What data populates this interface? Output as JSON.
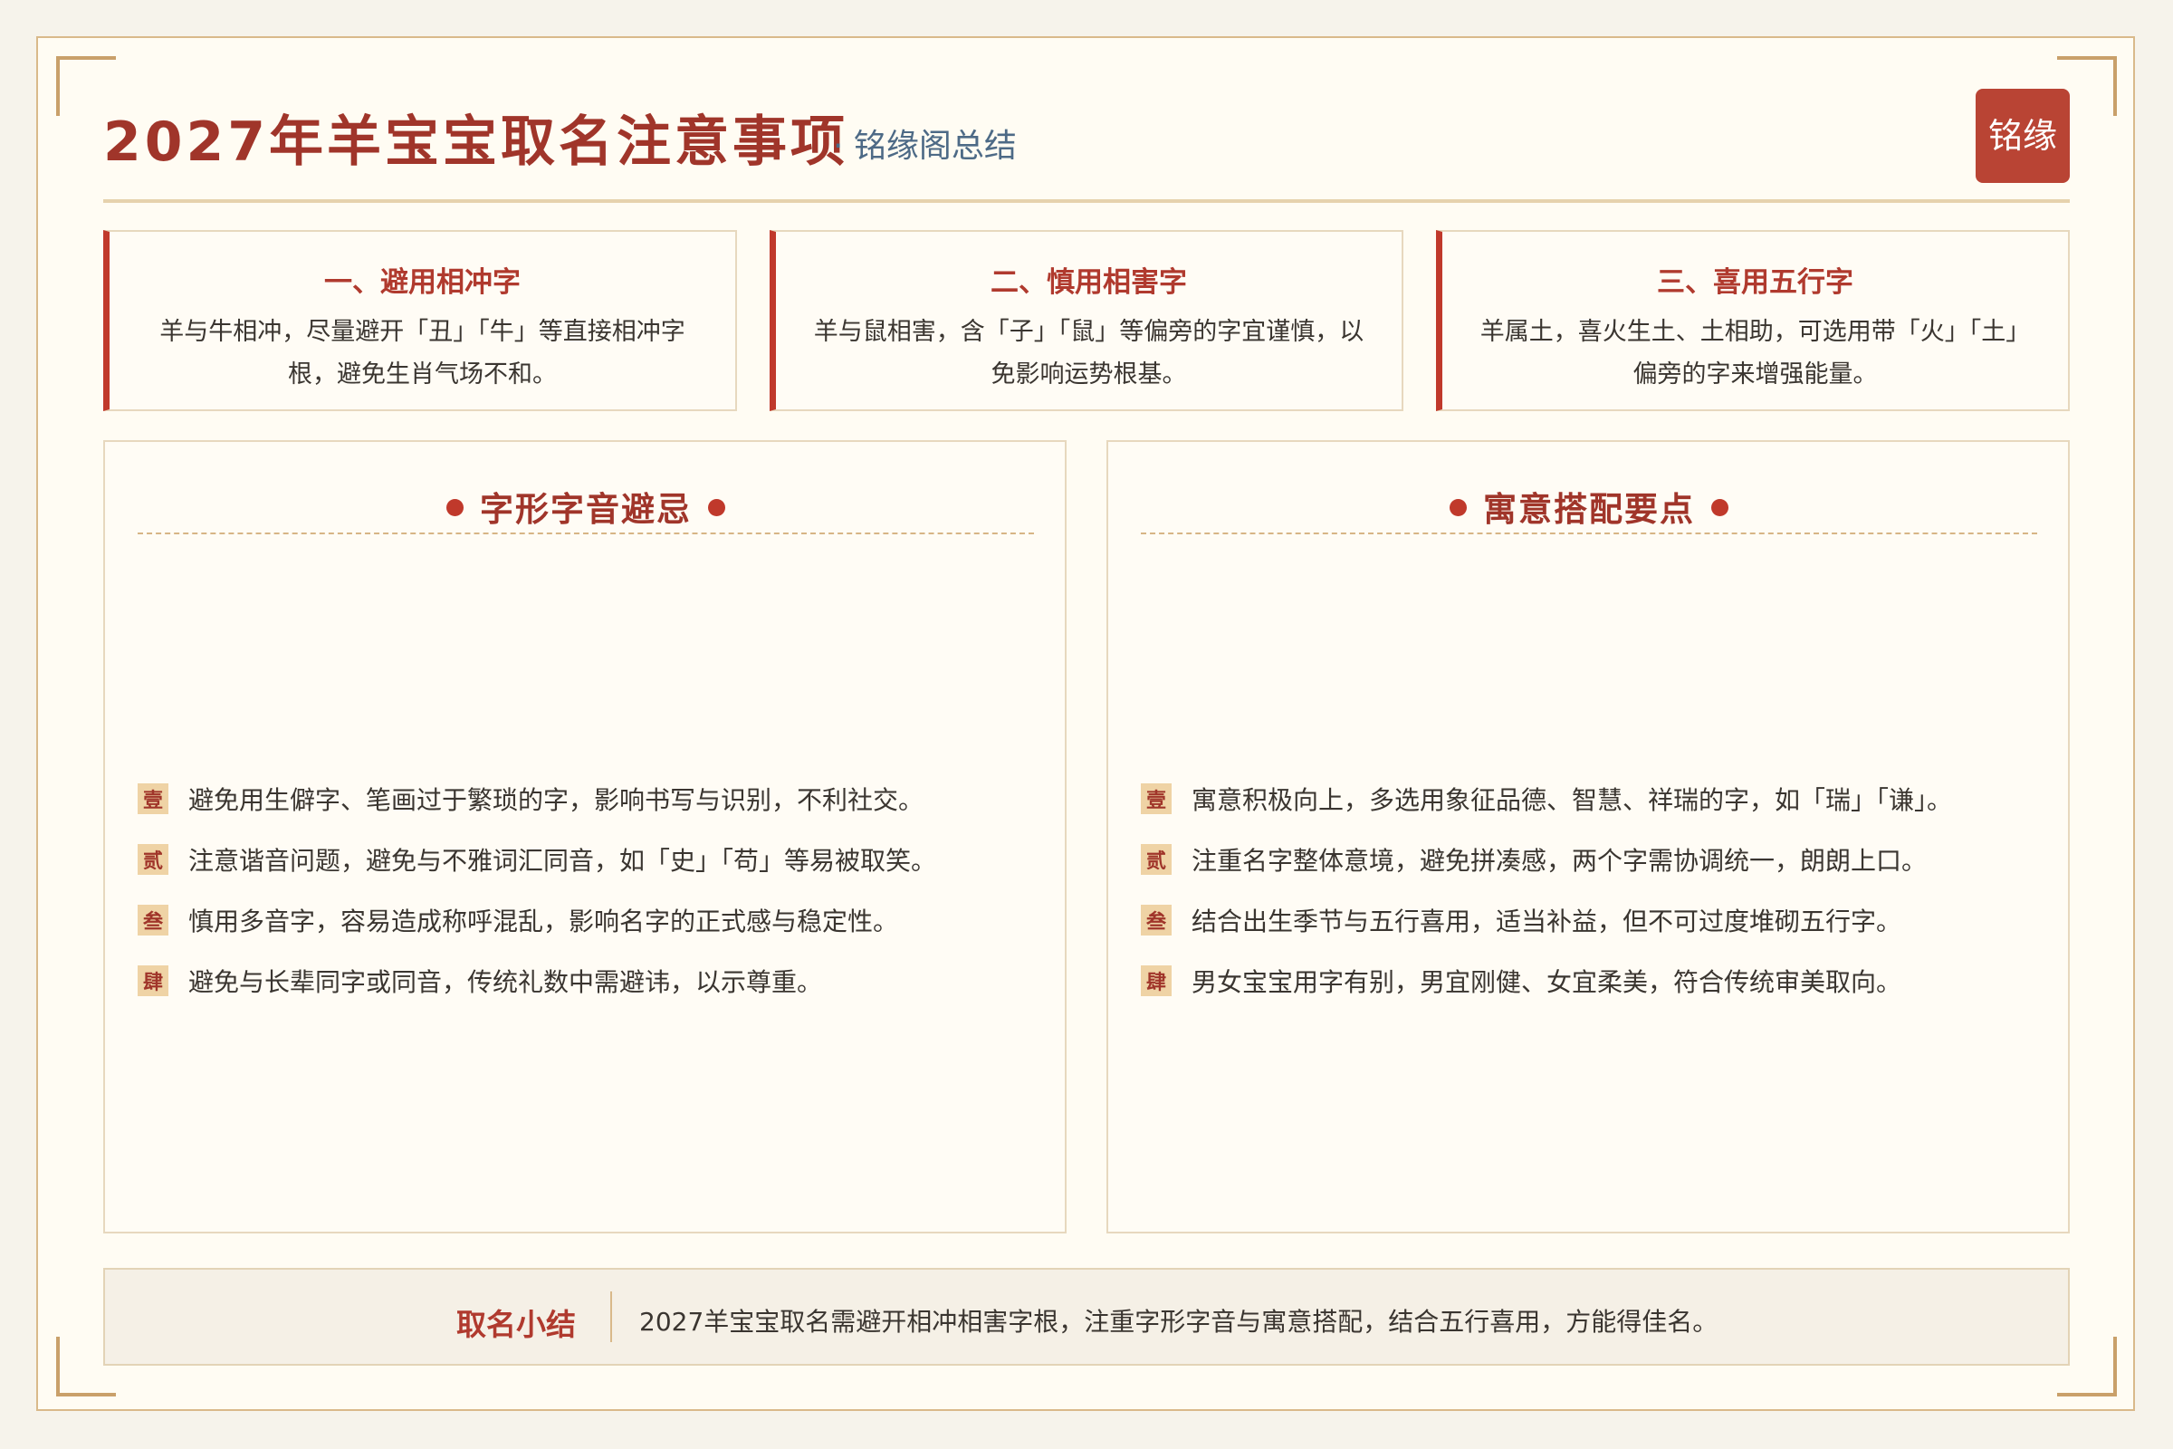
{
  "header": {
    "title": "2027年羊宝宝取名注意事项",
    "subtitle": "· 铭缘阁总结",
    "seal_text": "铭缘"
  },
  "tips": [
    {
      "title": "一、避用相冲字",
      "body": "羊与牛相冲，尽量避开「丑」「牛」等直接相冲字根，避免生肖气场不和。"
    },
    {
      "title": "二、慎用相害字",
      "body": "羊与鼠相害，含「子」「鼠」等偏旁的字宜谨慎，以免影响运势根基。"
    },
    {
      "title": "三、喜用五行字",
      "body": "羊属土，喜火生土、土相助，可选用带「火」「土」偏旁的字来增强能量。"
    }
  ],
  "left_panel": {
    "heading": "字形字音避忌",
    "items": [
      {
        "badge": "壹",
        "text": "避免用生僻字、笔画过于繁琐的字，影响书写与识别，不利社交。"
      },
      {
        "badge": "贰",
        "text": "注意谐音问题，避免与不雅词汇同音，如「史」「苟」等易被取笑。"
      },
      {
        "badge": "叁",
        "text": "慎用多音字，容易造成称呼混乱，影响名字的正式感与稳定性。"
      },
      {
        "badge": "肆",
        "text": "避免与长辈同字或同音，传统礼数中需避讳，以示尊重。"
      }
    ]
  },
  "right_panel": {
    "heading": "寓意搭配要点",
    "items": [
      {
        "badge": "壹",
        "text": "寓意积极向上，多选用象征品德、智慧、祥瑞的字，如「瑞」「谦」。"
      },
      {
        "badge": "贰",
        "text": "注重名字整体意境，避免拼凑感，两个字需协调统一，朗朗上口。"
      },
      {
        "badge": "叁",
        "text": "结合出生季节与五行喜用，适当补益，但不可过度堆砌五行字。"
      },
      {
        "badge": "肆",
        "text": "男女宝宝用字有别，男宜刚健、女宜柔美，符合传统审美取向。"
      }
    ]
  },
  "summary": {
    "label": "取名小结",
    "text": "2027羊宝宝取名需避开相冲相害字根，注重字形字音与寓意搭配，结合五行喜用，方能得佳名。"
  },
  "colors": {
    "accent": "#c0392b",
    "title": "#a0352a",
    "subtitle": "#4d6a86",
    "gold": "#d9b98a",
    "background": "#fffcf3"
  }
}
